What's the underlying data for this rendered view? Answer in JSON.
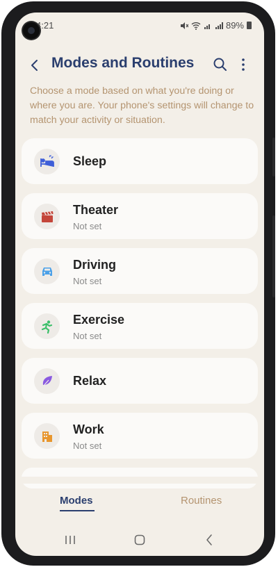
{
  "status_bar": {
    "time": "4:21",
    "battery_percent": "89%"
  },
  "header": {
    "title": "Modes and Routines"
  },
  "description": "Choose a mode based on what you're doing or where you are. Your phone's settings will change to match your activity or situation.",
  "modes": [
    {
      "name": "Sleep",
      "status": "",
      "icon": "bed-icon",
      "color": "#3f5fd8"
    },
    {
      "name": "Theater",
      "status": "Not set",
      "icon": "clapperboard-icon",
      "color": "#c4463a"
    },
    {
      "name": "Driving",
      "status": "Not set",
      "icon": "car-icon",
      "color": "#4aa0e8"
    },
    {
      "name": "Exercise",
      "status": "Not set",
      "icon": "running-icon",
      "color": "#3cbf6a"
    },
    {
      "name": "Relax",
      "status": "",
      "icon": "leaf-icon",
      "color": "#8a5ae0"
    },
    {
      "name": "Work",
      "status": "Not set",
      "icon": "building-icon",
      "color": "#e8962e"
    }
  ],
  "tabs": [
    {
      "label": "Modes",
      "selected": true
    },
    {
      "label": "Routines",
      "selected": false
    }
  ],
  "colors": {
    "accent": "#2a3e6e",
    "secondary_text": "#b49470",
    "background": "#f3efe8",
    "card": "#fbfaf8"
  }
}
